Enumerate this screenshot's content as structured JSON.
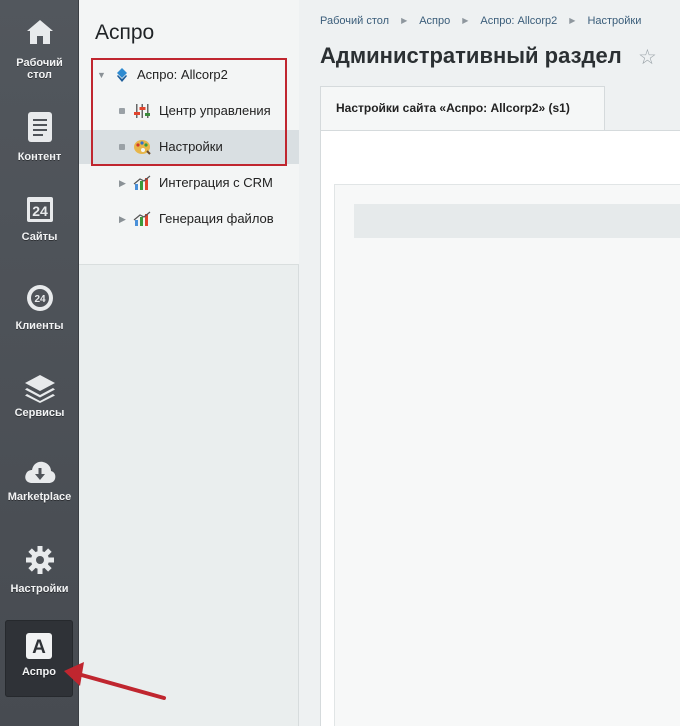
{
  "rail": {
    "items": [
      {
        "label": "Рабочий\nстол",
        "icon": "home-icon"
      },
      {
        "label": "Контент",
        "icon": "document-icon"
      },
      {
        "label": "Сайты",
        "icon": "calendar-24-icon"
      },
      {
        "label": "Клиенты",
        "icon": "clients-24-icon"
      },
      {
        "label": "Сервисы",
        "icon": "layers-icon"
      },
      {
        "label": "Marketplace",
        "icon": "cloud-download-icon"
      },
      {
        "label": "Настройки",
        "icon": "gear-icon"
      },
      {
        "label": "Аспро",
        "icon": "letter-a-icon"
      }
    ],
    "colors": {
      "bg": "#4f5359",
      "active": "#2f3237"
    }
  },
  "panel": {
    "title": "Аспро",
    "tree": [
      {
        "label": "Аспро: Allcorp2",
        "icon": "aspro-logo-icon",
        "expanded": true
      },
      {
        "label": "Центр управления",
        "icon": "sliders-icon"
      },
      {
        "label": "Настройки",
        "icon": "palette-icon",
        "selected": true
      },
      {
        "label": "Интеграция с CRM",
        "icon": "chart-icon"
      },
      {
        "label": "Генерация файлов",
        "icon": "chart-icon"
      }
    ]
  },
  "main": {
    "breadcrumbs": [
      "Рабочий стол",
      "Аспро",
      "Аспро: Allcorp2",
      "Настройки"
    ],
    "title": "Административный раздел",
    "tab": "Настройки сайта «Аспро: Allcorp2» (s1)"
  },
  "annotation": {
    "color": "#c0262f"
  }
}
